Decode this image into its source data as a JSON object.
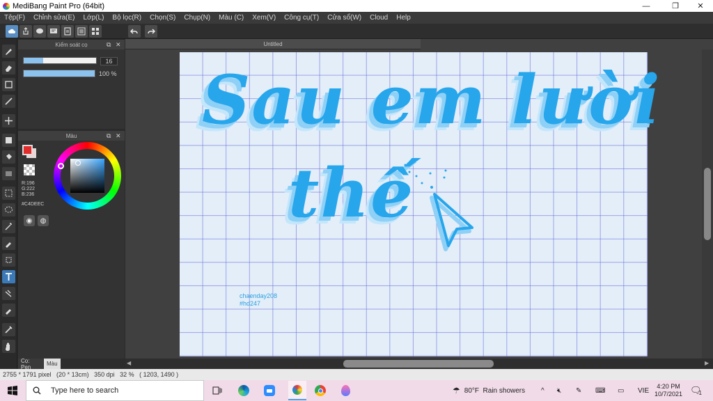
{
  "window": {
    "title": "MediBang Paint Pro (64bit)",
    "minimize": "—",
    "maximize": "❐",
    "close": "✕"
  },
  "menu": [
    "Tệp(F)",
    "Chỉnh sửa(E)",
    "Lớp(L)",
    "Bộ lọc(R)",
    "Chọn(S)",
    "Chụp(N)",
    "Màu (C)",
    "Xem(V)",
    "Công cụ(T)",
    "Cửa sổ(W)",
    "Cloud",
    "Help"
  ],
  "toolbar": {
    "icons": [
      "cloud-icon",
      "share-icon",
      "comment-icon",
      "comment-list-icon",
      "page-icon",
      "page-list-icon",
      "grid-icon",
      "undo-icon",
      "redo-icon"
    ]
  },
  "tools": [
    "brush-icon",
    "eraser-icon",
    "rectangle-icon",
    "line-icon",
    "move-icon",
    "fill-rect-icon",
    "bucket-icon",
    "gradient-icon",
    "select-rect-icon",
    "lasso-icon",
    "magic-wand-icon",
    "select-pen-icon",
    "select-eraser-icon",
    "text-icon",
    "divide-icon",
    "eyedropper-icon",
    "syringe-icon",
    "hand-icon"
  ],
  "brush_panel": {
    "title": "Kiểm soát cọ",
    "size_value": "16",
    "size_fraction": 0.27,
    "opacity_value": "100 %",
    "opacity_fraction": 1.0
  },
  "color_panel": {
    "title": "Màu",
    "r": "R:196",
    "g": "G:222",
    "b": "B:236",
    "hex": "#C4DEEC",
    "primary_color": "#e22b2b",
    "secondary_color": "#f6d3d3"
  },
  "bottom_tabs": {
    "brush": "Cọ: Pen",
    "color": "Màu"
  },
  "document": {
    "tab_title": "Untitled",
    "line1": "Sau em lười",
    "line2": "thế",
    "credit_line1": "chaenday208",
    "credit_line2": "#hd247"
  },
  "status": {
    "text": "2755 * 1791 pixel   (20 * 13cm)   350 dpi   32 %   ( 1203, 1490 )"
  },
  "taskbar": {
    "search_placeholder": "Type here to search",
    "weather": "80°F  Rain showers",
    "language": "VIE",
    "time": "4:20 PM",
    "date": "10/7/2021",
    "notification_count": "1"
  }
}
